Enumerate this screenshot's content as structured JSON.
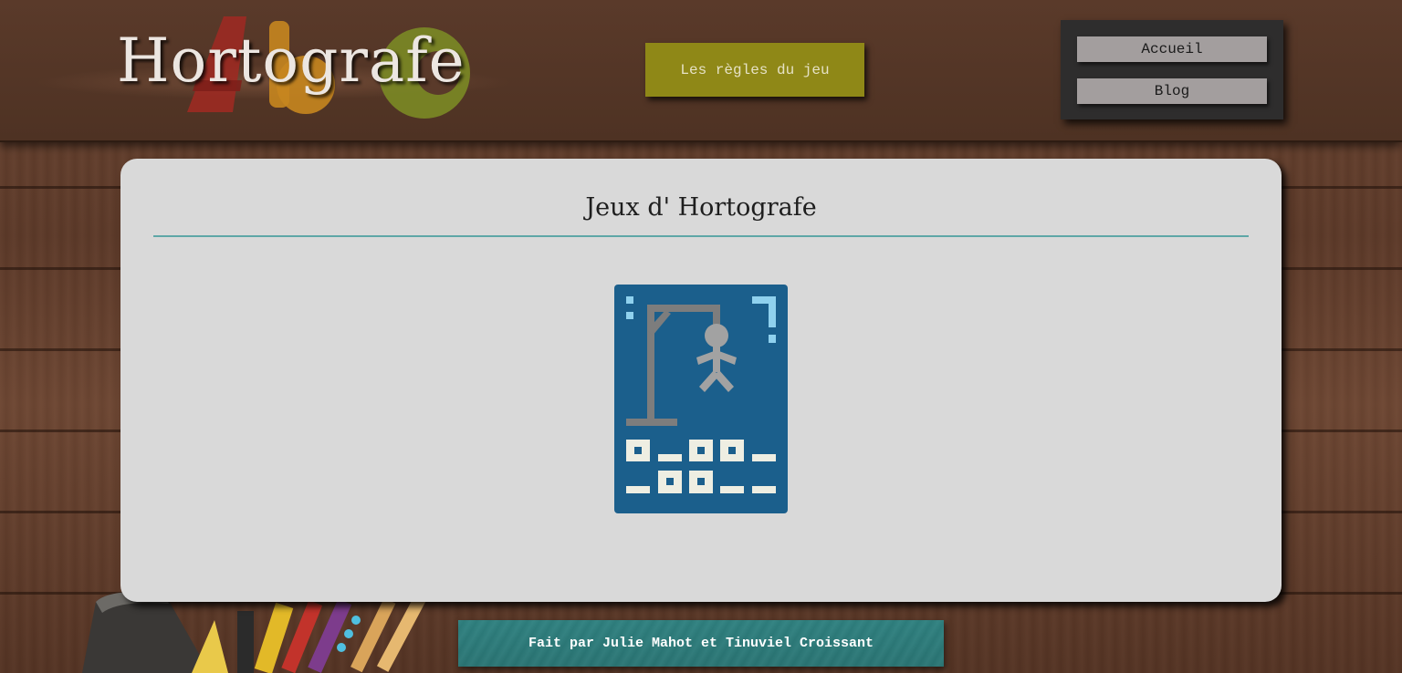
{
  "header": {
    "site_title": "Hortografe",
    "rules_button_label": "Les règles du jeu",
    "nav": {
      "accueil_label": "Accueil",
      "blog_label": "Blog"
    }
  },
  "main": {
    "title": "Jeux d' Hortografe",
    "games": [
      {
        "icon": "hangman-game-icon"
      }
    ]
  },
  "footer": {
    "credit": "Fait par Julie Mahot et Tinuviel Croissant"
  },
  "colors": {
    "rules_button": "#8f8817",
    "nav_box": "#2e2d2d",
    "nav_button": "#a39e9e",
    "card": "#d9d9d9",
    "title_rule": "#5ea7a7",
    "game_tile": "#1b5f8c",
    "footer": "#2f8180"
  }
}
